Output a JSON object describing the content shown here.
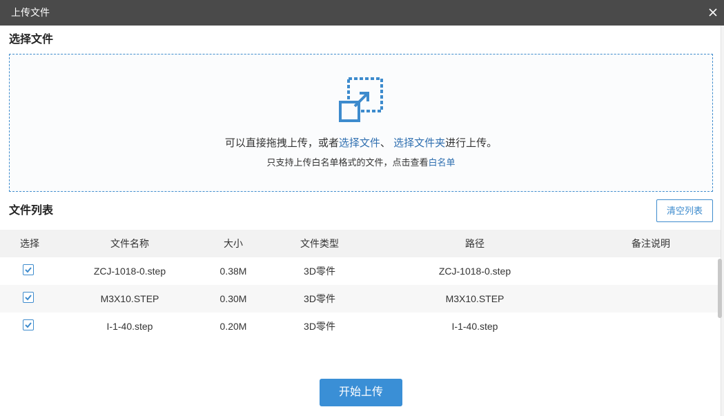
{
  "dialog": {
    "title": "上传文件"
  },
  "select_section": {
    "title": "选择文件",
    "hint_prefix": "可以直接拖拽上传，或者",
    "link_select_files": "选择文件",
    "separator": "、 ",
    "link_select_folder": "选择文件夹",
    "hint_suffix": "进行上传。",
    "sub_hint_prefix": "只支持上传白名单格式的文件，点击查看",
    "link_whitelist": "白名单"
  },
  "list_section": {
    "title": "文件列表",
    "clear_label": "清空列表",
    "columns": {
      "select": "选择",
      "name": "文件名称",
      "size": "大小",
      "type": "文件类型",
      "path": "路径",
      "note": "备注说明"
    },
    "rows": [
      {
        "checked": true,
        "name": "ZCJ-1018-0.step",
        "size": "0.38M",
        "type": "3D零件",
        "path": "ZCJ-1018-0.step",
        "note": ""
      },
      {
        "checked": true,
        "name": "M3X10.STEP",
        "size": "0.30M",
        "type": "3D零件",
        "path": "M3X10.STEP",
        "note": ""
      },
      {
        "checked": true,
        "name": "I-1-40.step",
        "size": "0.20M",
        "type": "3D零件",
        "path": "I-1-40.step",
        "note": ""
      }
    ]
  },
  "footer": {
    "start_label": "开始上传"
  },
  "colors": {
    "titlebar": "#4a4a4a",
    "accent": "#3a8fd6",
    "link": "#2f6fb0"
  },
  "icons": {
    "close": "close-icon",
    "upload": "upload-drag-icon",
    "check": "check-icon"
  }
}
